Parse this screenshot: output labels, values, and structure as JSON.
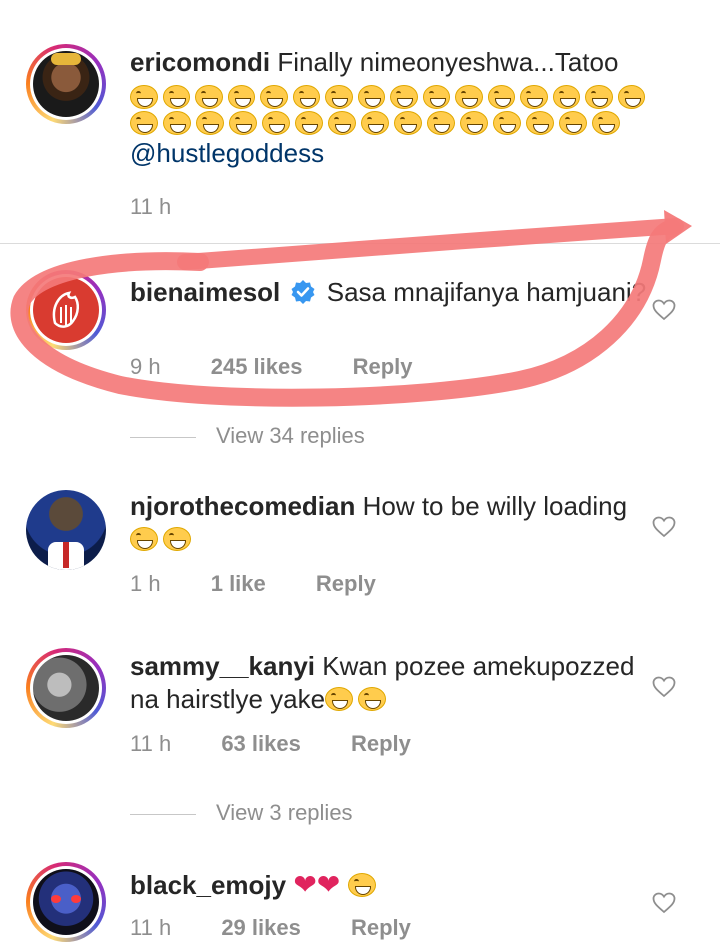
{
  "comments": [
    {
      "username": "ericomondi",
      "text": "Finally nimeonyeshwa...Tatoo",
      "mention": "@hustlegoddess",
      "time": "11 h",
      "emoji_row1_count": 16,
      "emoji_row2_count": 15
    },
    {
      "username": "bienaimesol",
      "verified": true,
      "text": "Sasa mnajifanya hamjuani?",
      "time": "9 h",
      "likes": "245 likes",
      "reply": "Reply",
      "view_replies": "View 34 replies"
    },
    {
      "username": "njorothecomedian",
      "text": "How to be willy loading",
      "time": "1 h",
      "likes": "1 like",
      "reply": "Reply"
    },
    {
      "username": "sammy__kanyi",
      "text": "Kwan pozee amekupozzed na hairstlye yake",
      "time": "11 h",
      "likes": "63 likes",
      "reply": "Reply",
      "view_replies": "View 3 replies"
    },
    {
      "username": "black_emojy",
      "text": "",
      "time": "11 h",
      "likes": "29 likes",
      "reply": "Reply"
    }
  ],
  "colors": {
    "annotation": "#f47a7a",
    "verified": "#3897f0",
    "mention": "#003569",
    "meta": "#8e8e8e"
  },
  "icons": {
    "heart": "heart-outline-icon",
    "verified": "verified-badge-icon",
    "emoji": "grinning-squinting-face-emoji"
  }
}
